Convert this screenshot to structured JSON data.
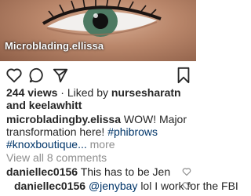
{
  "post": {
    "image_watermark": "Microblading.ellissa",
    "views": "244 views",
    "liked_by_prefix": "· Liked by",
    "liked_by_user1": "nursesharatn",
    "liked_by_and": "and",
    "liked_by_user2": "keelawhitt"
  },
  "caption": {
    "username": "microbladingby.elissa",
    "text": "WOW! Major transformation here!",
    "hashtags": "#phibrows #knoxboutique...",
    "more": "more"
  },
  "comments": {
    "view_all": "View all 8 comments",
    "items": [
      {
        "username": "daniellec0156",
        "text": "This has to be Jen"
      },
      {
        "username": "daniellec0156",
        "mention": "@jenybay",
        "text": "lol I work for the FBI"
      }
    ]
  },
  "icons": {
    "like": "heart-icon",
    "comment": "comment-icon",
    "share": "send-icon",
    "save": "bookmark-icon"
  },
  "colors": {
    "link": "#003569",
    "muted": "#8e8e8e",
    "text": "#262626"
  }
}
